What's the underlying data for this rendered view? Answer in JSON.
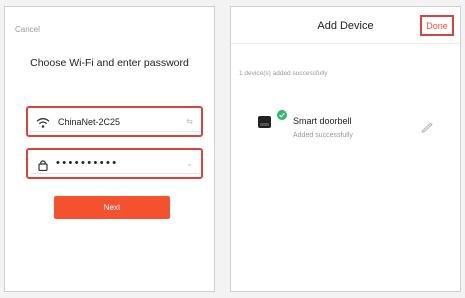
{
  "left_screen": {
    "cancel_label": "Cancel",
    "heading": "Choose Wi-Fi and enter password",
    "wifi_field": {
      "icon": "wifi-icon",
      "value": "ChinaNet-2C25",
      "right_glyph": "⇆"
    },
    "password_field": {
      "icon": "lock-icon",
      "value": "••••••••••",
      "right_glyph": "⌄"
    },
    "next_button": "Next"
  },
  "right_screen": {
    "title": "Add Device",
    "done_button": "Done",
    "added_count_text": "1 device(s) added successfully",
    "device": {
      "icon": "doorbell-device-icon",
      "badge": "check-badge",
      "name": "Smart doorbell",
      "status": "Added successfully",
      "edit_icon": "edit-pencil-icon"
    }
  },
  "colors": {
    "accent": "#f4522e",
    "highlight_border": "#d8453e",
    "success_badge": "#35b86b"
  }
}
